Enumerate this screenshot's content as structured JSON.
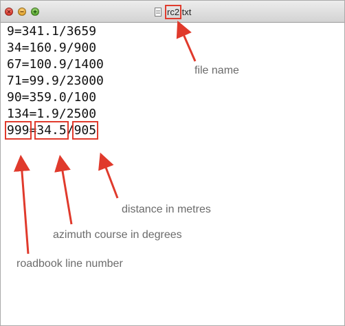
{
  "window": {
    "title_prefix": "rc2",
    "title_suffix": ".txt"
  },
  "editor": {
    "lines": [
      "9=341.1/3659",
      "34=160.9/900",
      "67=100.9/1400",
      "71=99.9/23000",
      "90=359.0/100",
      "134=1.9/2500"
    ],
    "example": {
      "line_number": "999",
      "separator_eq": "=",
      "azimuth": "34.5",
      "separator_slash": "/",
      "distance": "905"
    }
  },
  "annotations": {
    "file_name": "file name",
    "distance": "distance in metres",
    "azimuth": "azimuth course in degrees",
    "line_number": "roadbook line number"
  },
  "colors": {
    "annotation_red": "#e03a2c",
    "label_gray": "#6b6b6b"
  }
}
